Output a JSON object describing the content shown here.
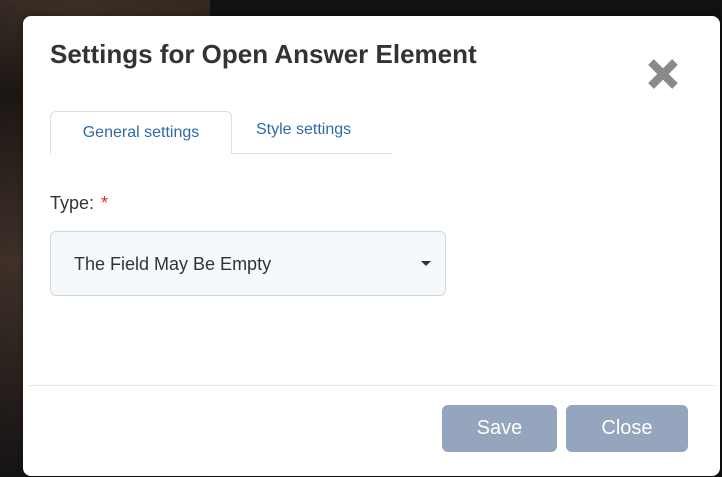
{
  "dialog": {
    "title": "Settings for Open Answer Element",
    "close_icon": "close-x-icon"
  },
  "tabs": [
    {
      "label": "General settings",
      "active": true
    },
    {
      "label": "Style settings",
      "active": false
    }
  ],
  "type_field": {
    "label": "Type:",
    "required_mark": "*",
    "selected_value": "The Field May Be Empty"
  },
  "footer": {
    "save_label": "Save",
    "close_label": "Close"
  },
  "colors": {
    "tab_text": "#2f6aa8",
    "required": "#e3262b",
    "button_bg": "#95a5bd",
    "title_text": "#333333",
    "close_icon": "#8a8a8a"
  }
}
